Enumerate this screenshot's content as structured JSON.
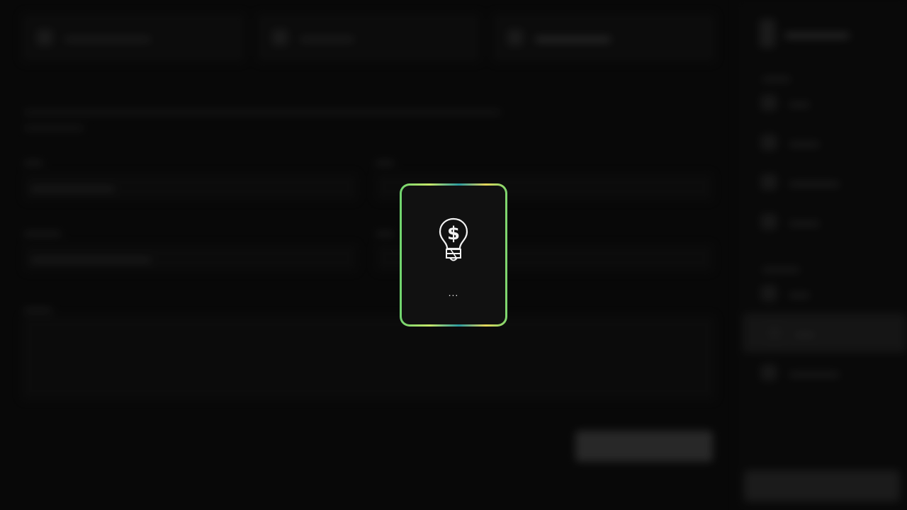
{
  "modal": {
    "icon": "lightbulb-dollar-icon",
    "loading_text": "...",
    "border_colors": [
      "#6fd46f",
      "#c8e86a",
      "#2a9aa0",
      "#e6d65a"
    ]
  }
}
